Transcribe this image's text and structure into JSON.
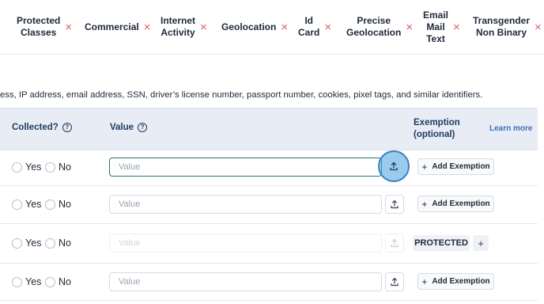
{
  "tabs": [
    {
      "label": "Protected\nClasses"
    },
    {
      "label": "Commercial"
    },
    {
      "label": "Internet\nActivity"
    },
    {
      "label": "Geolocation"
    },
    {
      "label": "Id\nCard"
    },
    {
      "label": "Precise\nGeolocation"
    },
    {
      "label": "Email\nMail\nText"
    },
    {
      "label": "Transgender\nNon Binary"
    }
  ],
  "tab_close_glyph": "×",
  "description": "ess, IP address, email address, SSN, driver’s license number, passport number, cookies, pixel tags, and similar identifiers.",
  "table": {
    "col_collected": "Collected?",
    "col_value": "Value",
    "col_exemption": "Exemption\n(optional)",
    "learn_more": "Learn more",
    "help_glyph": "?"
  },
  "rows": [
    {
      "yes": "Yes",
      "no": "No",
      "placeholder": "Value",
      "exemption_label": "Add Exemption",
      "state": "active"
    },
    {
      "yes": "Yes",
      "no": "No",
      "placeholder": "Value",
      "exemption_label": "Add Exemption",
      "state": "normal"
    },
    {
      "yes": "Yes",
      "no": "No",
      "placeholder": "Value",
      "protected_label": "PROTECTED",
      "state": "disabled"
    },
    {
      "yes": "Yes",
      "no": "No",
      "placeholder": "Value",
      "exemption_label": "Add Exemption",
      "state": "normal"
    }
  ],
  "colors": {
    "accent": "#2f6e76",
    "close": "#e0585b",
    "header_bg": "#e8edf5",
    "highlight": "#46a0dc"
  }
}
